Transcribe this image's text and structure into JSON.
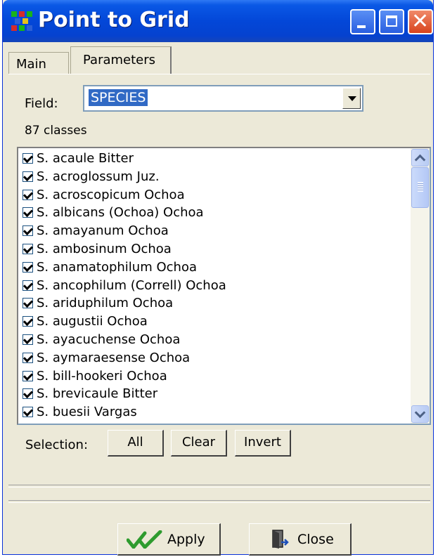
{
  "window": {
    "title": "Point to Grid"
  },
  "tabs": [
    {
      "label": "Main"
    },
    {
      "label": "Parameters"
    }
  ],
  "field": {
    "label": "Field:",
    "value": "SPECIES"
  },
  "classes_count": "87 classes",
  "species_list": [
    {
      "label": "S. acaule Bitter",
      "checked": true
    },
    {
      "label": "S. acroglossum Juz.",
      "checked": true
    },
    {
      "label": "S. acroscopicum Ochoa",
      "checked": true
    },
    {
      "label": "S. albicans (Ochoa) Ochoa",
      "checked": true
    },
    {
      "label": "S. amayanum Ochoa",
      "checked": true
    },
    {
      "label": "S. ambosinum Ochoa",
      "checked": true
    },
    {
      "label": "S. anamatophilum Ochoa",
      "checked": true
    },
    {
      "label": "S. ancophilum (Correll) Ochoa",
      "checked": true
    },
    {
      "label": "S. ariduphilum Ochoa",
      "checked": true
    },
    {
      "label": "S. augustii Ochoa",
      "checked": true
    },
    {
      "label": "S. ayacuchense Ochoa",
      "checked": true
    },
    {
      "label": "S. aymaraesense Ochoa",
      "checked": true
    },
    {
      "label": "S. bill-hookeri Ochoa",
      "checked": true
    },
    {
      "label": "S. brevicaule Bitter",
      "checked": true
    },
    {
      "label": "S. buesii Vargas",
      "checked": true
    }
  ],
  "selection": {
    "label": "Selection:",
    "all_label": "All",
    "clear_label": "Clear",
    "invert_label": "Invert"
  },
  "footer": {
    "apply_label": "Apply",
    "close_label": "Close"
  },
  "colors": {
    "titlebar": "#0347d8",
    "highlight": "#316ac5",
    "apply_check": "#2e9b2e"
  },
  "icons": {
    "app": "grid-colors-icon",
    "apply": "double-check-icon",
    "close": "door-exit-icon"
  }
}
